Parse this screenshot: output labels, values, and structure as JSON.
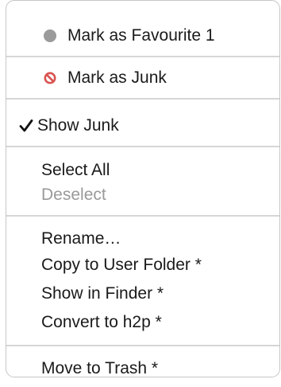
{
  "menu": {
    "mark_favourite": {
      "label": "Mark as Favourite 1",
      "icon": "gray-dot-icon",
      "dot_color": "#9b9b9b"
    },
    "mark_junk": {
      "label": "Mark as Junk",
      "icon": "no-entry-icon",
      "icon_color": "#d9534f"
    },
    "show_junk": {
      "label": "Show Junk",
      "checked": true,
      "icon": "checkmark-icon"
    },
    "select_all": {
      "label": "Select All"
    },
    "deselect": {
      "label": "Deselect",
      "enabled": false
    },
    "rename": {
      "label": "Rename…"
    },
    "copy_user_folder": {
      "label": "Copy to User Folder *"
    },
    "show_finder": {
      "label": "Show in Finder *"
    },
    "convert_h2p": {
      "label": "Convert to h2p *"
    },
    "move_trash": {
      "label": "Move to Trash *"
    }
  }
}
